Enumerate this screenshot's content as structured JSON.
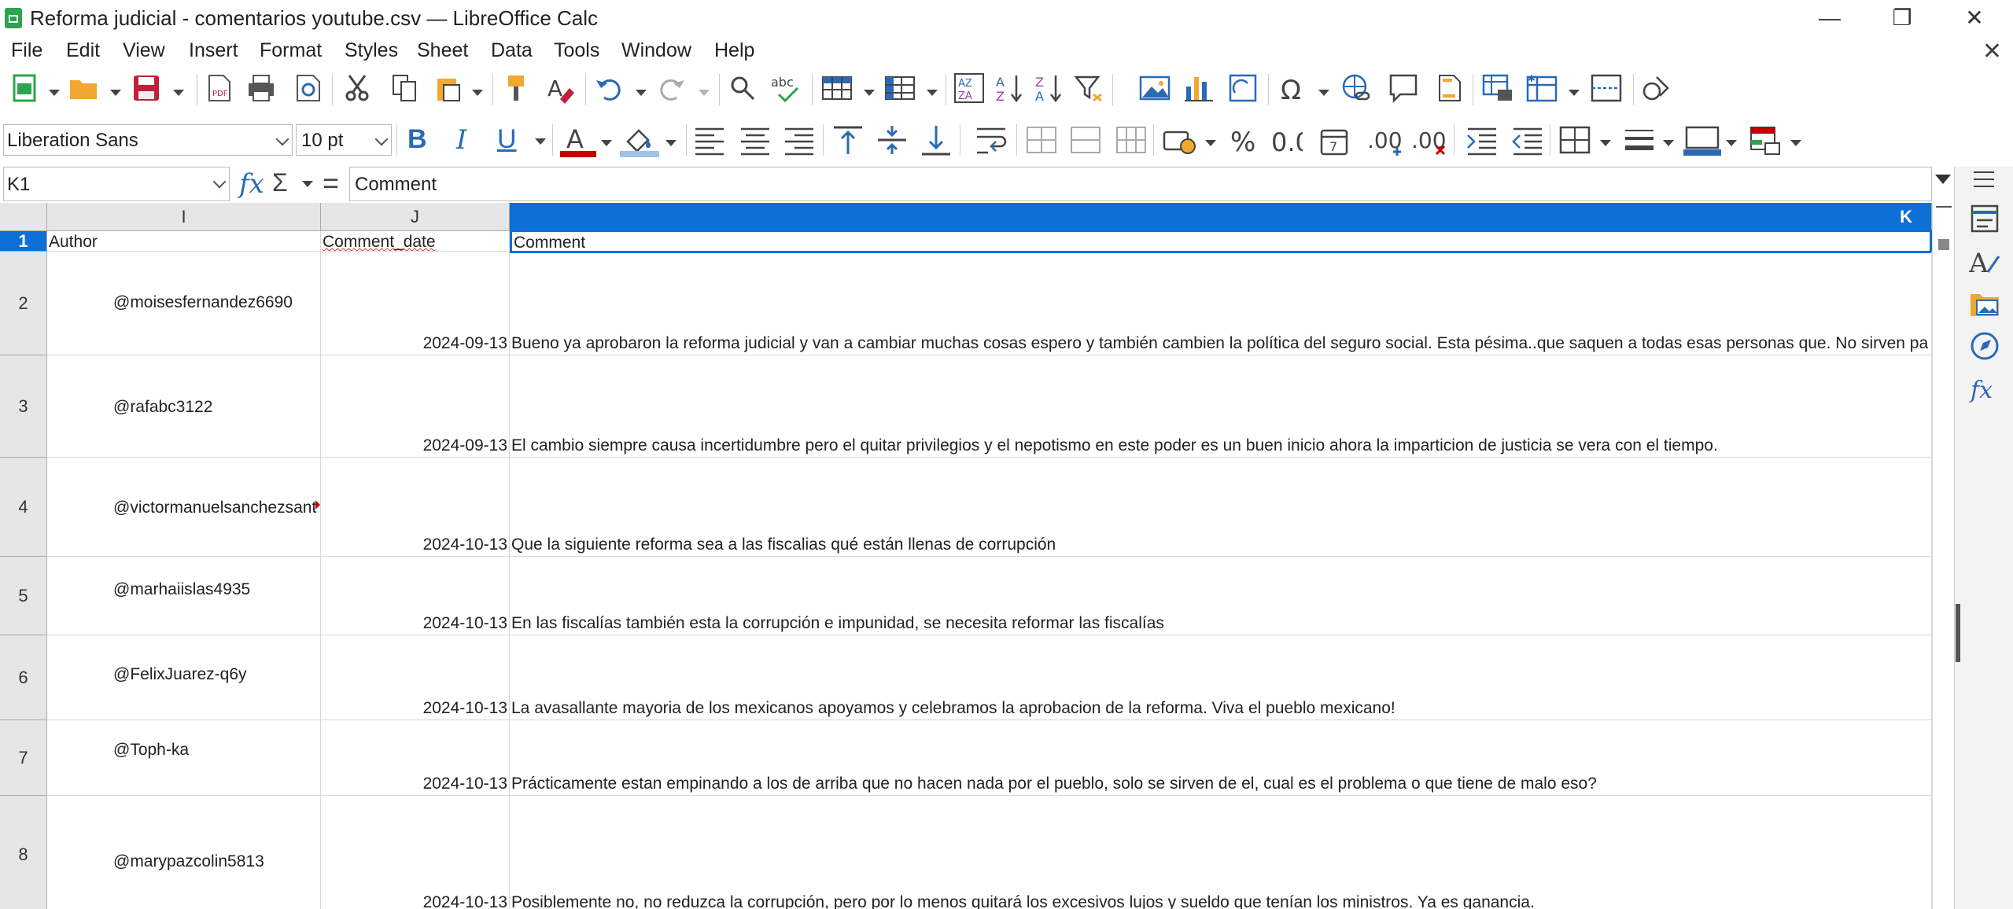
{
  "window": {
    "title": "Reforma judicial - comentarios youtube.csv — LibreOffice Calc",
    "minimize": "—",
    "maximize": "❐",
    "close": "✕"
  },
  "menu": [
    "File",
    "Edit",
    "View",
    "Insert",
    "Format",
    "Styles",
    "Sheet",
    "Data",
    "Tools",
    "Window",
    "Help"
  ],
  "menu_close": "✕",
  "toolbar_format": {
    "font_name": "Liberation Sans",
    "font_size": "10 pt",
    "bold": "B",
    "italic": "I",
    "underline": "U"
  },
  "formula_bar": {
    "cell_ref": "K1",
    "fx": "fx",
    "sigma": "Σ",
    "equals": "=",
    "content": "Comment"
  },
  "columns": [
    {
      "id": "I",
      "selected": false
    },
    {
      "id": "J",
      "selected": false
    },
    {
      "id": "K",
      "selected": true
    }
  ],
  "rows": [
    {
      "num": "1",
      "author": "Author",
      "date": "Comment_date",
      "comment": "Comment"
    },
    {
      "num": "2",
      "author": "@moisesfernandez6690",
      "date": "2024-09-13",
      "comment": "Bueno ya aprobaron la reforma judicial y van a cambiar muchas cosas espero y también cambien la política del seguro social. Esta pésima..que saquen a todas esas personas que. No sirven pa"
    },
    {
      "num": "3",
      "author": "@rafabc3122",
      "date": "2024-09-13",
      "comment": "El cambio siempre causa incertidumbre pero el quitar privilegios y el nepotismo en este poder es un buen inicio ahora la imparticion de justicia se vera con el tiempo."
    },
    {
      "num": "4",
      "author": "@victormanuelsanchezsant",
      "date": "2024-10-13",
      "comment": "Que la siguiente reforma sea a las fiscalias qué están llenas de corrupción"
    },
    {
      "num": "5",
      "author": "@marhaiislas4935",
      "date": "2024-10-13",
      "comment": "En las fiscalías también esta la corrupción e impunidad, se necesita reformar las fiscalías"
    },
    {
      "num": "6",
      "author": "@FelixJuarez-q6y",
      "date": "2024-10-13",
      "comment": "La avasallante mayoria de los mexicanos apoyamos y celebramos la aprobacion de la reforma. Viva el pueblo mexicano!"
    },
    {
      "num": "7",
      "author": "@Toph-ka",
      "date": "2024-10-13",
      "comment": "Prácticamente estan empinando a los de arriba que no hacen nada por el pueblo, solo se sirven de el, cual es el problema o que tiene de malo eso?"
    },
    {
      "num": "8",
      "author": "@marypazcolin5813",
      "date": "2024-10-13",
      "comment": "Posiblemente no, no  reduzca la corrupción, pero por lo menos quitará los excesivos lujos y sueldo que tenían los ministros. Ya es ganancia."
    }
  ],
  "colors": {
    "selection": "#0d70d6",
    "header_bg": "#e6e6e6",
    "calc_green": "#2ca44d"
  }
}
